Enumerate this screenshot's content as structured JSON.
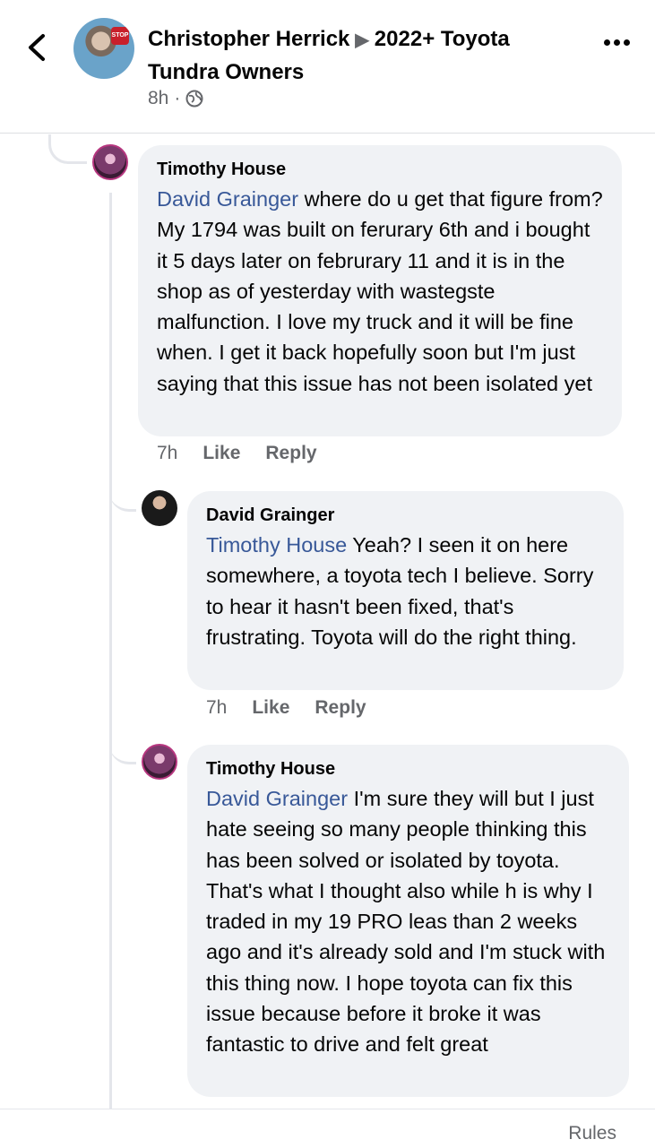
{
  "header": {
    "author": "Christopher Herrick",
    "group": "2022+ Toyota Tundra Owners",
    "time": "8h",
    "separator": "·"
  },
  "comments": [
    {
      "author": "Timothy House",
      "mention": "David Grainger",
      "text": " where do u get that figure from?  My 1794 was built on ferurary 6th and i bought it 5 days later on februrary 11 and it is in the shop as of yesterday with wastegste malfunction. I love my truck and it will be fine when. I get it back hopefully soon but I'm just saying that this issue has not been isolated yet",
      "time": "7h",
      "like": "Like",
      "reply": "Reply"
    },
    {
      "author": "David Grainger",
      "mention": "Timothy House",
      "text": " Yeah? I seen it on here somewhere, a toyota tech I believe. Sorry to hear it hasn't been fixed, that's frustrating. Toyota will do the right thing.",
      "time": "7h",
      "like": "Like",
      "reply": "Reply"
    },
    {
      "author": "Timothy House",
      "mention": "David Grainger",
      "text": " I'm sure they will but I just hate seeing so many people thinking this has been solved or isolated by toyota. That's what I thought also while h is why I traded in my 19 PRO leas than 2 weeks ago and it's already sold and I'm stuck with this thing now. I hope toyota can fix this issue because before it broke it was fantastic to drive and felt great"
    }
  ],
  "footer": {
    "rules": "Rules"
  },
  "colors": {
    "mention": "#385898",
    "bubble": "#f0f2f5",
    "meta": "#65676b"
  }
}
